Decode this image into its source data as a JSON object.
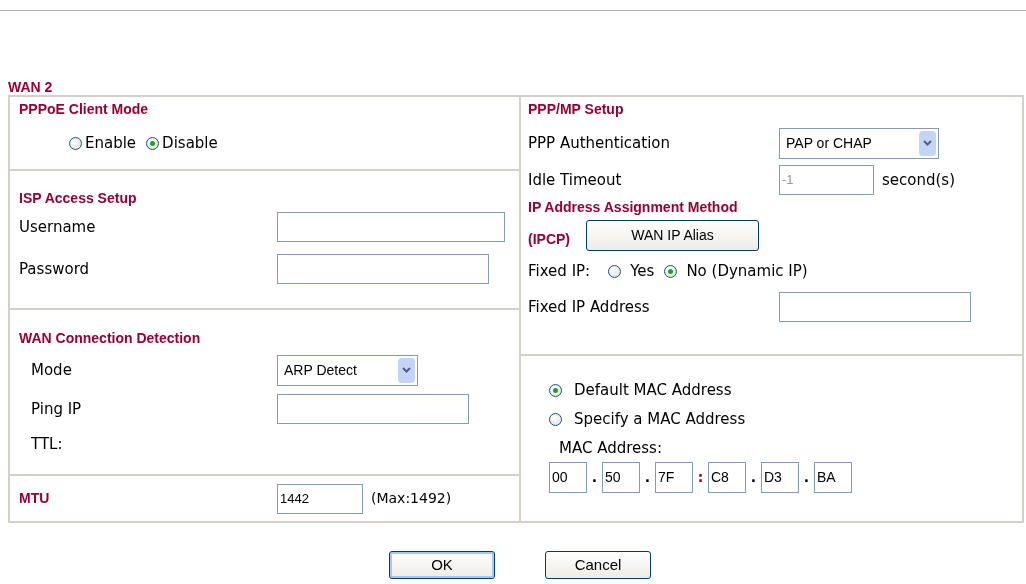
{
  "section_title": "WAN 2",
  "pppoe": {
    "title": "PPPoE Client Mode",
    "options": [
      {
        "label": "Enable",
        "selected": false
      },
      {
        "label": "Disable",
        "selected": true
      }
    ]
  },
  "isp": {
    "title": "ISP Access Setup",
    "fields": [
      {
        "label": "Username"
      },
      {
        "label": "Password"
      }
    ]
  },
  "detection": {
    "title": "WAN Connection Detection",
    "mode": {
      "label": "Mode",
      "value": "ARP Detect"
    },
    "ping_ip": {
      "label": "Ping IP"
    },
    "ttl": {
      "label": "TTL:"
    }
  },
  "mtu": {
    "label": "MTU",
    "value": "1442",
    "hint": "(Max:1492)"
  },
  "ppp": {
    "title": "PPP/MP Setup",
    "auth": {
      "label": "PPP Authentication",
      "value": "PAP or CHAP"
    },
    "idle": {
      "label": "Idle Timeout",
      "value": "-1",
      "disabled": true,
      "unit": "second(s)"
    }
  },
  "ip": {
    "title": "IP Address Assignment Method",
    "subtitle": "(IPCP)",
    "alias_button": "WAN IP Alias",
    "fixed_ip": {
      "label": "Fixed IP:",
      "options": [
        {
          "label": "Yes",
          "selected": false
        },
        {
          "label": "No (Dynamic IP)",
          "selected": true
        }
      ]
    },
    "address": {
      "label": "Fixed IP Address"
    }
  },
  "mac": {
    "options": [
      {
        "label": "Default MAC Address",
        "selected": true
      },
      {
        "label": "Specify a MAC Address",
        "selected": false
      }
    ],
    "label": "MAC Address:",
    "octets": [
      "00",
      "50",
      "7F",
      "C8",
      "D3",
      "BA"
    ],
    "separators": [
      ".",
      ".",
      ":",
      ".",
      "."
    ]
  },
  "buttons": [
    {
      "label": "OK",
      "default": true
    },
    {
      "label": "Cancel",
      "default": false
    }
  ]
}
